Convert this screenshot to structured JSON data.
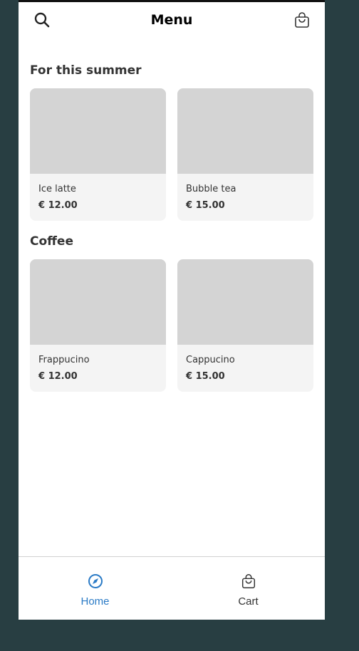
{
  "header": {
    "title": "Menu",
    "left_icon": "search-icon",
    "right_icon": "shopping-bag-icon"
  },
  "sections": [
    {
      "title": "For this summer",
      "items": [
        {
          "name": "Ice latte",
          "price": "€ 12.00"
        },
        {
          "name": "Bubble tea",
          "price": "€ 15.00"
        }
      ]
    },
    {
      "title": "Coffee",
      "items": [
        {
          "name": "Frappucino",
          "price": "€ 12.00"
        },
        {
          "name": "Cappucino",
          "price": "€ 15.00"
        }
      ]
    }
  ],
  "nav": [
    {
      "label": "Home",
      "icon": "compass-icon",
      "active": true,
      "color": "#2b7bc6"
    },
    {
      "label": "Cart",
      "icon": "shopping-bag-icon",
      "active": false,
      "color": "#333333"
    }
  ]
}
